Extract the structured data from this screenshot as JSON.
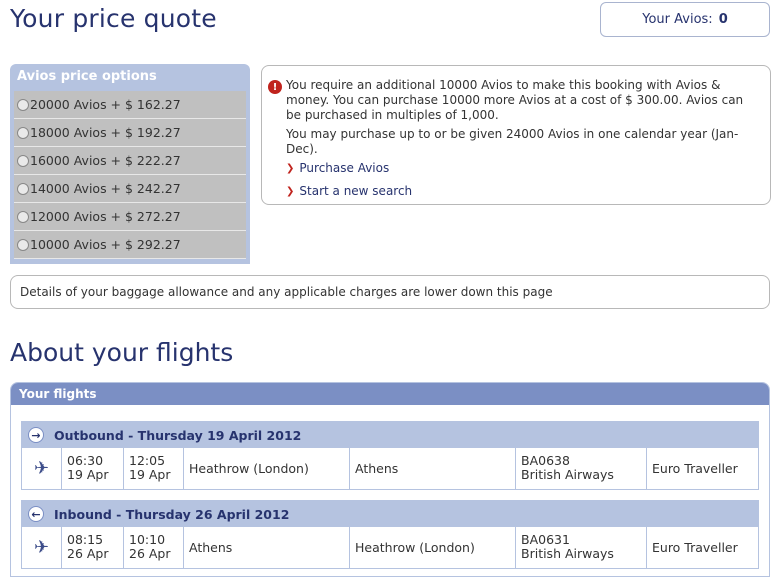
{
  "header": {
    "title": "Your price quote",
    "avios_label": "Your Avios:",
    "avios_value": "0"
  },
  "price_options": {
    "title": "Avios price options",
    "options": [
      "20000 Avios + $ 162.27",
      "18000 Avios + $ 192.27",
      "16000 Avios + $ 222.27",
      "14000 Avios + $ 242.27",
      "12000 Avios + $ 272.27",
      "10000 Avios + $ 292.27"
    ]
  },
  "warning": {
    "line1": "You require an additional 10000 Avios to make this booking with Avios & money. You can purchase 10000 more Avios at a cost of $ 300.00. Avios can be purchased in multiples of 1,000.",
    "line2": "You may purchase up to or be given 24000 Avios in one calendar year (Jan-Dec).",
    "link_purchase": "Purchase Avios",
    "link_search": "Start a new search"
  },
  "baggage_note": "Details of your baggage allowance and any applicable charges are lower down this page",
  "flights": {
    "section_title": "About your flights",
    "panel_title": "Your flights",
    "outbound": {
      "heading": "Outbound - Thursday 19 April 2012",
      "dep_time": "06:30",
      "dep_date": "19 Apr",
      "arr_time": "12:05",
      "arr_date": "19 Apr",
      "from": "Heathrow (London)",
      "to": "Athens",
      "flight_no": "BA0638",
      "airline": "British Airways",
      "cabin": "Euro Traveller"
    },
    "inbound": {
      "heading": "Inbound - Thursday 26 April 2012",
      "dep_time": "08:15",
      "dep_date": "26 Apr",
      "arr_time": "10:10",
      "arr_date": "26 Apr",
      "from": "Athens",
      "to": "Heathrow (London)",
      "flight_no": "BA0631",
      "airline": "British Airways",
      "cabin": "Euro Traveller"
    }
  }
}
